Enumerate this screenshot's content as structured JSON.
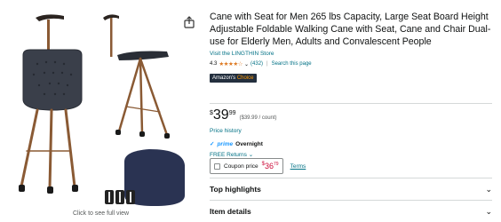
{
  "gallery": {
    "see_full_view": "Click to see full view"
  },
  "product": {
    "title": "Cane with Seat for Men 265 lbs Capacity, Large Seat Board Height Adjustable Foldable Walking Cane with Seat, Cane and Chair Dual-use for Elderly Men, Adults and Convalescent People",
    "store_link": "Visit the LINGTHIN Store",
    "rating_value": "4.3",
    "stars": "★★★★☆",
    "rating_dropdown": "⌄",
    "rating_count": "(432)",
    "search_link": "Search this page",
    "badge_prefix": "Amazon's",
    "badge_suffix": "Choice"
  },
  "price": {
    "symbol": "$",
    "whole": "39",
    "fraction": "99",
    "unit_price": "($39.99 / count)",
    "history_link": "Price history",
    "prime_check": "✓",
    "prime_word": "prime",
    "prime_delivery": "Overnight",
    "free_returns": "FREE Returns ⌄"
  },
  "coupon": {
    "label": "Coupon price",
    "symbol": "$",
    "whole": "36",
    "fraction": "79",
    "terms": "Terms"
  },
  "sections": {
    "top_highlights": "Top highlights",
    "item_details": "Item details"
  },
  "colors": {
    "link": "#007185",
    "prime": "#1a98ff",
    "coupon_red": "#cc0c39",
    "badge_bg": "#232f3e",
    "star": "#de7921",
    "cane_bronze": "#8a5a34",
    "seat_navy": "#2a3352"
  }
}
